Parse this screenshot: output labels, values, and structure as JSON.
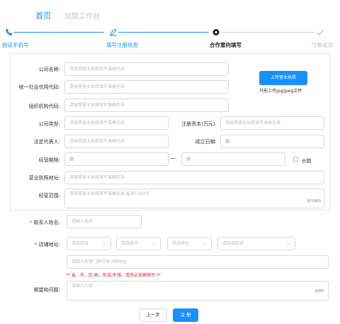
{
  "nav": {
    "home": "首页",
    "workbench": "加盟工作台"
  },
  "steps": [
    {
      "label": "验证手机号",
      "icon": "phone-icon",
      "state": "done"
    },
    {
      "label": "填写注册信息",
      "icon": "pen-icon",
      "state": "done"
    },
    {
      "label": "合作意向填写",
      "icon": "gear-icon",
      "state": "active"
    },
    {
      "label": "注册成功",
      "icon": "check-icon",
      "state": "pending"
    }
  ],
  "form": {
    "company_name": {
      "label": "公司名称:",
      "placeholder": "请按照营业执照填写准确信息"
    },
    "credit_code": {
      "label": "统一社会信用代码:",
      "placeholder": "请按照营业执照填写准确信息"
    },
    "org_code": {
      "label": "组织机构代码:",
      "placeholder": "请按照营业执照填写准确信息"
    },
    "company_type": {
      "label": "公司类型:",
      "placeholder": "请按照营业执照填写准确信息"
    },
    "reg_capital": {
      "label": "注册资本(万元):",
      "placeholder": "请按照营业执照填写准确信息"
    },
    "legal_rep": {
      "label": "法定代表人:",
      "placeholder": "请按照营业执照填写准确信息"
    },
    "established": {
      "label": "成立日期:"
    },
    "term": {
      "label": "经营期限:",
      "dash": "—",
      "long_term": "长期"
    },
    "license_address": {
      "label": "营业执照地址:",
      "placeholder": "请按照营业执照填写准确信息"
    },
    "business_scope": {
      "label": "经营范围:",
      "placeholder": "请按照营业执照填写准确信息,最多1000字",
      "counter": "0/1000"
    },
    "upload": {
      "button": "上传营业执照",
      "hint": "只能上传jpg/jpeg文件"
    },
    "contact_name": {
      "star": "*",
      "label": "联系人姓名:",
      "placeholder": "请输入姓名"
    },
    "store_address": {
      "star": "*",
      "label": "店铺地址:",
      "province": "请选择省",
      "city": "请选择市",
      "district": "请选择区",
      "street": "请选择街道",
      "detail_placeholder": "请输入街道门牌号等详细地址",
      "warning": "** 省、市、区/县、街道/乡镇、请务必准确填写 **"
    },
    "expectation": {
      "label": "期望和问题:",
      "placeholder": "请输入内容",
      "counter": "0/80"
    }
  },
  "buttons": {
    "prev": "上一步",
    "register": "注 册"
  },
  "colors": {
    "primary": "#1890ff",
    "danger": "#f5222d",
    "step_done": "#1890ff",
    "step_active": "#222222",
    "step_pending": "#c0c0c0"
  }
}
